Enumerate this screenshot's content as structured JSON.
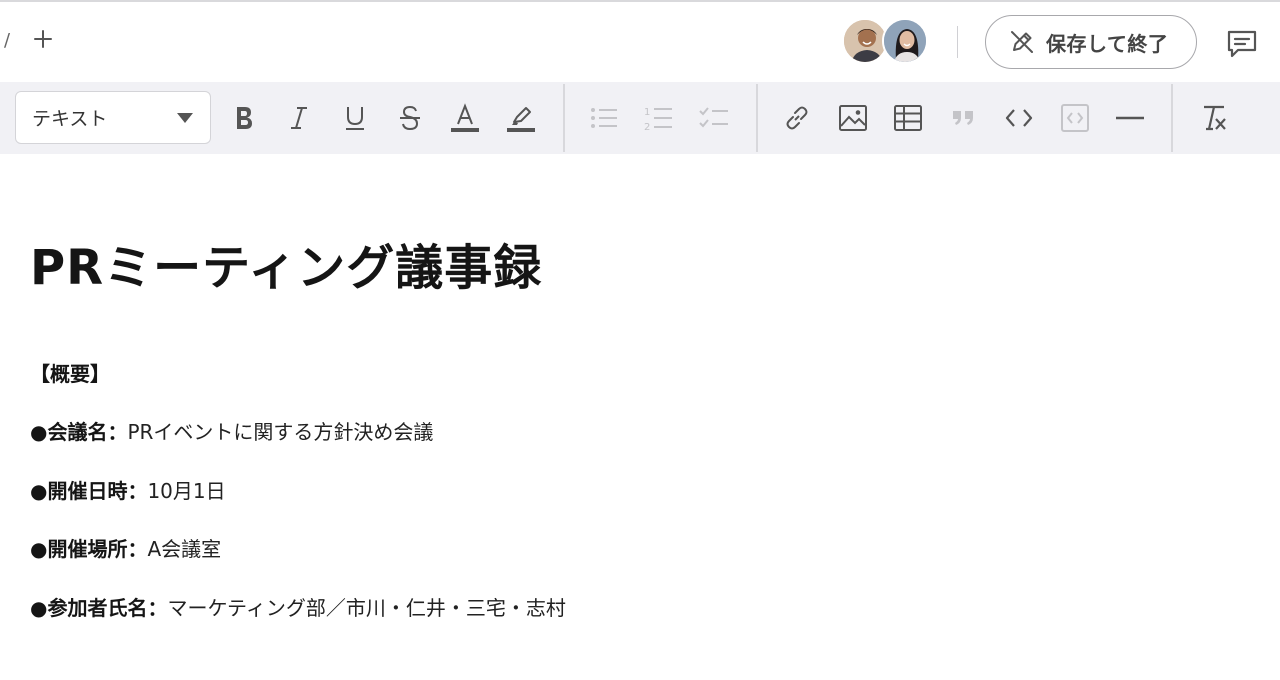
{
  "header": {
    "breadcrumb_separator": "/",
    "add_page_icon": "plus-icon",
    "avatars": [
      {
        "name_icon": "user-avatar-1"
      },
      {
        "name_icon": "user-avatar-2"
      }
    ],
    "save_button": {
      "label": "保存して終了",
      "icon": "pencil-off-icon"
    },
    "comment_icon": "comment-icon"
  },
  "toolbar": {
    "format_select": {
      "value": "テキスト"
    },
    "buttons": [
      "bold",
      "italic",
      "underline",
      "strikethrough",
      "text-color",
      "highlight",
      "bullet-list",
      "numbered-list",
      "checklist",
      "link",
      "image",
      "table",
      "quote",
      "code",
      "code-block",
      "horizontal-rule",
      "clear-format"
    ]
  },
  "document": {
    "title": "PRミーティング議事録",
    "section_heading": "【概要】",
    "lines": [
      {
        "key": "●会議名：",
        "value": "PRイベントに関する方針決め会議"
      },
      {
        "key": "●開催日時：",
        "value": "10月1日"
      },
      {
        "key": "●開催場所：",
        "value": "A会議室"
      },
      {
        "key": "●参加者氏名：",
        "value": "マーケティング部／市川・仁井・三宅・志村"
      }
    ]
  },
  "colors": {
    "toolbar_bg": "#f1f1f5",
    "icon_active": "#555555",
    "icon_disabled": "#c4c4c8",
    "text": "#151515"
  }
}
